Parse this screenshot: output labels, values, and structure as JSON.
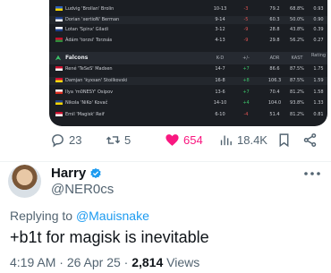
{
  "stats": {
    "top_rows": [
      {
        "player": "Ludvig 'Brollan' Brolin",
        "flag": "#2a5fbf",
        "flag2": "#f5d400",
        "kd": "10-13",
        "diff": "-3",
        "adr": "79.2",
        "kast": "68.8%",
        "rating": "0.93"
      },
      {
        "player": "Dorian 'xertioN' Berman",
        "flag": "#1e3f8a",
        "flag2": "#ffffff",
        "kd": "9-14",
        "diff": "-5",
        "adr": "60.3",
        "kast": "50.0%",
        "rating": "0.90"
      },
      {
        "player": "Lotan 'Spinx' Giladi",
        "flag": "#ffffff",
        "flag2": "#1e3f8a",
        "kd": "3-12",
        "diff": "-9",
        "adr": "28.8",
        "kast": "43.8%",
        "rating": "0.39"
      },
      {
        "player": "Ádám 'torzsi' Torzsás",
        "flag": "#c8102e",
        "flag2": "#2f8a3b",
        "kd": "4-13",
        "diff": "-9",
        "adr": "29.8",
        "kast": "56.2%",
        "rating": "0.27"
      }
    ],
    "team_name": "Falcons",
    "headers": {
      "kd": "K-D",
      "diff": "+/-",
      "adr": "ADR",
      "kast": "KAST",
      "rating": "Rating"
    },
    "bottom_rows": [
      {
        "player": "René 'TeSeS' Madsen",
        "flag": "#c8102e",
        "flag2": "#ffffff",
        "kd": "14-7",
        "diff": "+7",
        "adr": "86.6",
        "kast": "87.5%",
        "rating": "1.75"
      },
      {
        "player": "Damjan 'kyxsan' Stoilkovski",
        "flag": "#d21034",
        "flag2": "#f8d90f",
        "kd": "16-8",
        "diff": "+8",
        "adr": "106.3",
        "kast": "87.5%",
        "rating": "1.59"
      },
      {
        "player": "Ilya 'm0NESY' Osipov",
        "flag": "#ffffff",
        "flag2": "#d52b1e",
        "kd": "13-6",
        "diff": "+7",
        "adr": "70.4",
        "kast": "81.2%",
        "rating": "1.58"
      },
      {
        "player": "Nikola 'NiKo' Kovač",
        "flag": "#1e3f8a",
        "flag2": "#f5d400",
        "kd": "14-10",
        "diff": "+4",
        "adr": "104.0",
        "kast": "93.8%",
        "rating": "1.33"
      },
      {
        "player": "Emil 'Magisk' Reif",
        "flag": "#c8102e",
        "flag2": "#ffffff",
        "kd": "6-10",
        "diff": "-4",
        "adr": "51.4",
        "kast": "81.2%",
        "rating": "0.81"
      }
    ]
  },
  "actions": {
    "replies": "23",
    "retweets": "5",
    "likes": "654",
    "views": "18.4K"
  },
  "reply": {
    "name": "Harry",
    "handle": "@NER0cs",
    "replying_prefix": "Replying to ",
    "replying_to": "@Mauisnake",
    "text": "+b1t for magisk is inevitable",
    "time": "4:19 AM",
    "date": "26 Apr 25",
    "view_count": "2,814",
    "views_label": "Views"
  },
  "colors": {
    "accent": "#1d9bf0",
    "like": "#f91880",
    "muted": "#536471",
    "text": "#0f1419"
  }
}
